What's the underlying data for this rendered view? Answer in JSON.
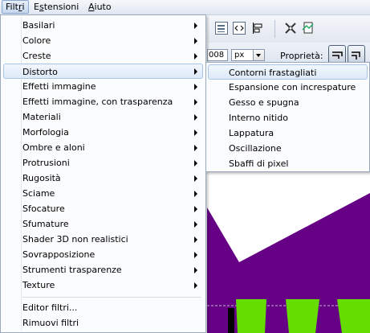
{
  "menubar": {
    "items": [
      {
        "label": "Filtri",
        "access": "i"
      },
      {
        "label": "Estensioni",
        "access": "s"
      },
      {
        "label": "Aiuto",
        "access": "A"
      }
    ]
  },
  "toolbar": {
    "spin_value": "008",
    "unit": "px",
    "properties_label": "Proprietà:"
  },
  "filters_menu": {
    "items": [
      {
        "label": "Basilari",
        "submenu": true
      },
      {
        "label": "Colore",
        "submenu": true
      },
      {
        "label": "Creste",
        "submenu": true
      },
      {
        "label": "Distorto",
        "submenu": true,
        "highlighted": true
      },
      {
        "label": "Effetti immagine",
        "submenu": true
      },
      {
        "label": "Effetti immagine, con trasparenza",
        "submenu": true
      },
      {
        "label": "Materiali",
        "submenu": true
      },
      {
        "label": "Morfologia",
        "submenu": true
      },
      {
        "label": "Ombre e aloni",
        "submenu": true
      },
      {
        "label": "Protrusioni",
        "submenu": true
      },
      {
        "label": "Rugosità",
        "submenu": true
      },
      {
        "label": "Sciame",
        "submenu": true
      },
      {
        "label": "Sfocature",
        "submenu": true
      },
      {
        "label": "Sfumature",
        "submenu": true
      },
      {
        "label": "Shader 3D non realistici",
        "submenu": true
      },
      {
        "label": "Sovrapposizione",
        "submenu": true
      },
      {
        "label": "Strumenti trasparenze",
        "submenu": true
      },
      {
        "label": "Texture",
        "submenu": true
      }
    ],
    "footer_items": [
      {
        "label": "Editor filtri..."
      },
      {
        "label": "Rimuovi filtri"
      }
    ]
  },
  "distorto_submenu": {
    "items": [
      {
        "label": "Contorni frastagliati",
        "highlighted": true
      },
      {
        "label": "Espansione con increspature"
      },
      {
        "label": "Gesso e spugna"
      },
      {
        "label": "Interno nitido"
      },
      {
        "label": "Lappatura"
      },
      {
        "label": "Oscillazione"
      },
      {
        "label": "Sbaffi di pixel"
      }
    ]
  },
  "colors": {
    "canvas_purple": "#660085",
    "accent_green": "#66dd00",
    "menu_highlight": "#dce9f8"
  }
}
